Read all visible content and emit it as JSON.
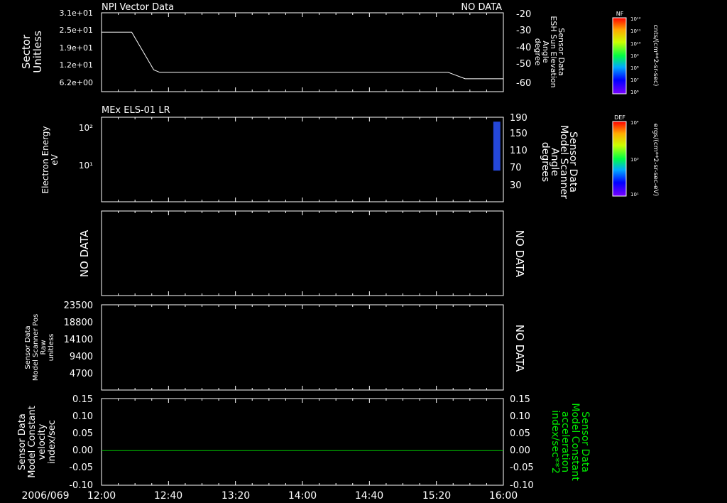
{
  "figure": {
    "date_label": "2006/069",
    "time_ticks": [
      "12:00",
      "12:40",
      "13:20",
      "14:00",
      "14:40",
      "15:20",
      "16:00"
    ],
    "time_range_hours": [
      12,
      16
    ]
  },
  "colors": {
    "background": "#000000",
    "axis": "#ffffff",
    "trace": "#ffffff",
    "zero_line": "#00cc00",
    "accel_label": "#00ee00"
  },
  "colorbars": [
    {
      "label": "NF",
      "unit": "cnts/(cm**2-sr-sec)",
      "ticks": [
        "10¹²",
        "10¹¹",
        "10¹⁰",
        "10⁹",
        "10⁸",
        "10⁷",
        "10⁶"
      ]
    },
    {
      "label": "DEF",
      "unit": "ergs/(cm**2-sr-sec-eV)",
      "ticks": [
        "10⁴",
        "10³",
        "10¹"
      ]
    }
  ],
  "chart_data": [
    {
      "type": "line",
      "title": "NPI Vector Data",
      "status": "NO DATA",
      "ylabel": [
        "Sector",
        "Unitless"
      ],
      "yticks_left": [
        "3.1e+01",
        "2.5e+01",
        "1.9e+01",
        "1.2e+01",
        "6.2e+00"
      ],
      "ylabel_right": [
        "Sensor Data",
        "ESH Sun Elevation",
        "Angle",
        "degree"
      ],
      "yticks_right": [
        "-20",
        "-30",
        "-40",
        "-50",
        "-60"
      ],
      "ylim_right": [
        -67,
        -18
      ],
      "series": [
        {
          "x": [
            12.0,
            12.3,
            12.52,
            12.58,
            15.45,
            15.62,
            16.0
          ],
          "y": [
            -30,
            -30,
            -53.5,
            -55,
            -55,
            -59,
            -59
          ]
        }
      ]
    },
    {
      "type": "heatmap",
      "title": "MEx ELS-01 LR",
      "ylabel": [
        "Electron Energy",
        "eV"
      ],
      "yticks_left": [
        "10²",
        "10¹"
      ],
      "ylabel_right": [
        "Sensor Data",
        "Model Scanner",
        "Angle",
        "degrees"
      ],
      "yticks_right": [
        "190",
        "150",
        "110",
        "70",
        "30"
      ],
      "ylim_right": [
        0,
        190
      ],
      "cells": [
        {
          "x": [
            15.9,
            15.97
          ],
          "y": [
            70,
            180
          ]
        }
      ]
    },
    {
      "type": "line",
      "status_left": "NO DATA",
      "status_right": "NO DATA"
    },
    {
      "type": "line",
      "ylabel": [
        "Sensor Data",
        "Model Scanner Pos",
        "Raw",
        "unitless"
      ],
      "yticks_left": [
        "23500",
        "18800",
        "14100",
        "9400",
        "4700"
      ],
      "ylim": [
        0,
        23500
      ],
      "status_right": "NO DATA"
    },
    {
      "type": "line",
      "ylabel": [
        "Sensor Data",
        "Model Constant",
        "velocity",
        "index/sec"
      ],
      "ylabel_right": [
        "Sensor Data",
        "Model Constant",
        "acceleration",
        "index/sec**2"
      ],
      "yticks_left": [
        "0.15",
        "0.10",
        "0.05",
        "0.00",
        "-0.05",
        "-0.10"
      ],
      "yticks_right": [
        "0.15",
        "0.10",
        "0.05",
        "0.00",
        "-0.05",
        "-0.10"
      ],
      "ylim": [
        -0.1,
        0.15
      ],
      "series": [
        {
          "x": [
            12,
            16
          ],
          "y": [
            0,
            0
          ]
        }
      ]
    }
  ]
}
